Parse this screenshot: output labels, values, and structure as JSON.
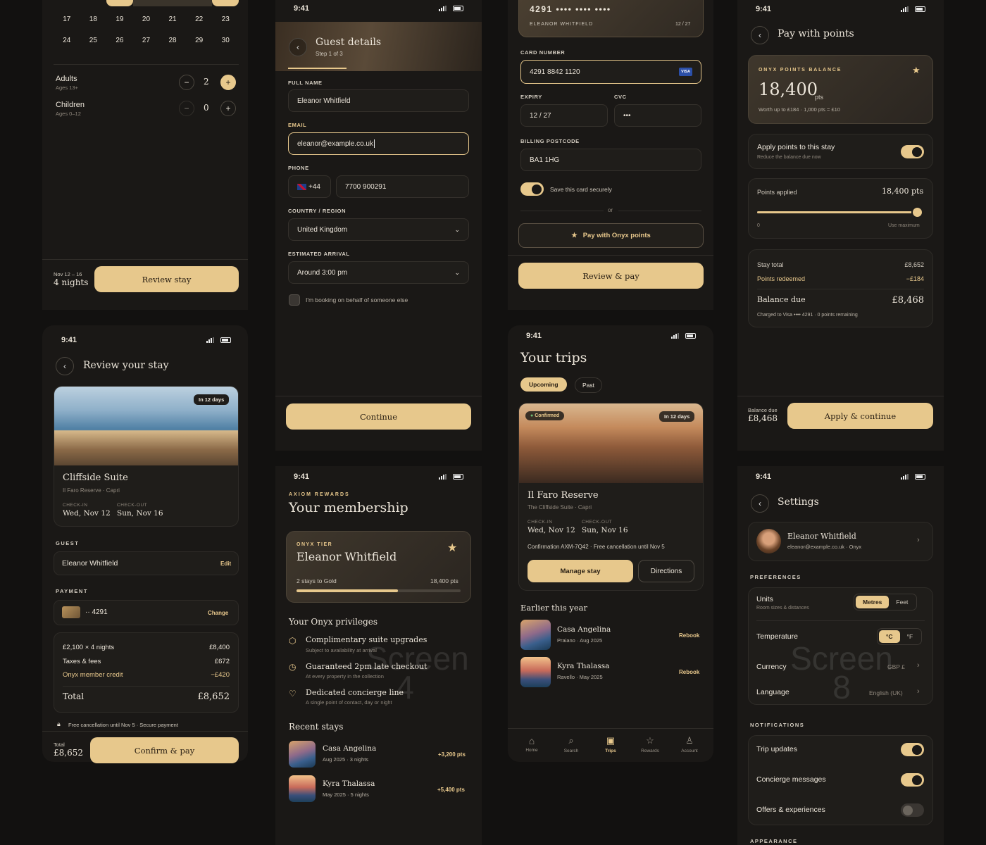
{
  "s1": {
    "cal": [
      "17",
      "18",
      "19",
      "20",
      "21",
      "22",
      "23",
      "24",
      "25",
      "26",
      "27",
      "28",
      "29",
      "30"
    ],
    "adults": "Adults",
    "adults_sub": "Ages 13+",
    "adults_n": "2",
    "children": "Children",
    "children_sub": "Ages 0–12",
    "children_n": "0",
    "dates": "Nov 12 – 16",
    "nights": "4 nights",
    "cta": "Review stay"
  },
  "s2": {
    "time": "9:41",
    "title": "Guest details",
    "step": "Step 1 of 3",
    "full_name_lbl": "FULL NAME",
    "full_name": "Eleanor Whitfield",
    "email_lbl": "EMAIL",
    "email": "eleanor@example.co.uk",
    "phone_lbl": "PHONE",
    "cc": "+44",
    "phone": "7700 900291",
    "country_lbl": "COUNTRY / REGION",
    "country": "United Kingdom",
    "arrival_lbl": "ESTIMATED ARRIVAL",
    "arrival": "Around 3:00 pm",
    "behalf": "I'm booking on behalf of someone else",
    "cta": "Continue"
  },
  "s3": {
    "card_no": "4291 •••• •••• ••••",
    "holder": "ELEANOR WHITFIELD",
    "card_exp": "12 / 27",
    "num_lbl": "CARD NUMBER",
    "num": "4291 8842 1120",
    "visa": "VISA",
    "exp_lbl": "EXPIRY",
    "exp": "12 / 27",
    "cvc_lbl": "CVC",
    "cvc": "•••",
    "post_lbl": "BILLING POSTCODE",
    "post": "BA1 1HG",
    "save": "Save this card securely",
    "or": "or",
    "points_btn": "Pay with Onyx points",
    "cta": "Review & pay"
  },
  "s4": {
    "time": "9:41",
    "title": "Pay with points",
    "bal_lbl": "ONYX POINTS BALANCE",
    "bal": "18,400",
    "pts": "pts",
    "worth": "Worth up to £184 · 1,000 pts = £10",
    "apply": "Apply points to this stay",
    "apply_sub": "Reduce the balance due now",
    "applied_lbl": "Points applied",
    "applied": "18,400 pts",
    "min": "0",
    "max": "Use maximum",
    "slider_fraction": 1,
    "stay_total_lbl": "Stay total",
    "stay_total": "£8,652",
    "redeemed_lbl": "Points redeemed",
    "redeemed": "−£184",
    "due_lbl": "Balance due",
    "due": "£8,468",
    "charged": "Charged to Visa •••• 4291 · 0 points remaining",
    "foot_lbl": "Balance due",
    "foot_val": "£8,468",
    "cta": "Apply & continue"
  },
  "s5": {
    "time": "9:41",
    "title": "Review your stay",
    "badge": "In 12 days",
    "room": "Cliffside Suite",
    "hotel": "Il Faro Reserve · Capri",
    "in_lbl": "CHECK-IN",
    "in": "Wed, Nov 12",
    "out_lbl": "CHECK-OUT",
    "out": "Sun, Nov 16",
    "guest_lbl": "GUEST",
    "guest": "Eleanor Whitfield",
    "edit": "Edit",
    "pay_lbl": "PAYMENT",
    "card": "·· 4291",
    "change": "Change",
    "l1": "£2,100 × 4 nights",
    "v1": "£8,400",
    "l2": "Taxes & fees",
    "v2": "£672",
    "l3": "Onyx member credit",
    "v3": "−£420",
    "total_lbl": "Total",
    "total": "£8,652",
    "policy": "Free cancellation until Nov 5 · Secure payment",
    "foot_lbl": "Total",
    "foot_val": "£8,652",
    "cta": "Confirm & pay"
  },
  "s6": {
    "time": "9:41",
    "kicker": "AXIOM REWARDS",
    "title": "Your membership",
    "tier": "ONYX TIER",
    "name": "Eleanor Whitfield",
    "progress": "2 stays to Gold",
    "progress_fraction": 0.62,
    "points": "18,400 pts",
    "priv_title": "Your Onyx privileges",
    "p1": "Complimentary suite upgrades",
    "p1s": "Subject to availability at arrival",
    "p2": "Guaranteed 2pm late checkout",
    "p2s": "At every property in the collection",
    "p3": "Dedicated concierge line",
    "p3s": "A single point of contact, day or night",
    "recent": "Recent stays",
    "r1": "Casa Angelina",
    "r1s": "Aug 2025 · 3 nights",
    "r1p": "+3,200 pts",
    "r2": "Kyra Thalassa",
    "r2s": "May 2025 · 5 nights",
    "r2p": "+5,400 pts"
  },
  "s7": {
    "time": "9:41",
    "title": "Your trips",
    "tab1": "Upcoming",
    "tab2": "Past",
    "status": "Confirmed",
    "badge": "In 12 days",
    "hotel": "Il Faro Reserve",
    "suite": "The Cliffside Suite · Capri",
    "in_lbl": "CHECK-IN",
    "in": "Wed, Nov 12",
    "out_lbl": "CHECK-OUT",
    "out": "Sun, Nov 16",
    "conf": "Confirmation AXM-7Q42 · Free cancellation until Nov 5",
    "manage": "Manage stay",
    "directions": "Directions",
    "earlier": "Earlier this year",
    "e1": "Casa Angelina",
    "e1s": "Praiano · Aug 2025",
    "e2": "Kyra Thalassa",
    "e2s": "Ravello · May 2025",
    "rebook": "Rebook",
    "nav": [
      "Home",
      "Search",
      "Trips",
      "Rewards",
      "Account"
    ]
  },
  "s8": {
    "time": "9:41",
    "title": "Settings",
    "name": "Eleanor Whitfield",
    "email": "eleanor@example.co.uk · Onyx",
    "pref": "PREFERENCES",
    "units": "Units",
    "units_sub": "Room sizes & distances",
    "metres": "Metres",
    "feet": "Feet",
    "temp": "Temperature",
    "c": "°C",
    "f": "°F",
    "currency": "Currency",
    "currency_val": "GBP £",
    "language": "Language",
    "language_val": "English (UK)",
    "notif": "NOTIFICATIONS",
    "n1": "Trip updates",
    "n2": "Concierge messages",
    "n3": "Offers & experiences",
    "appearance": "APPEARANCE"
  },
  "watermarks": {
    "w4": "Screen 4",
    "w8": "Screen 8"
  }
}
